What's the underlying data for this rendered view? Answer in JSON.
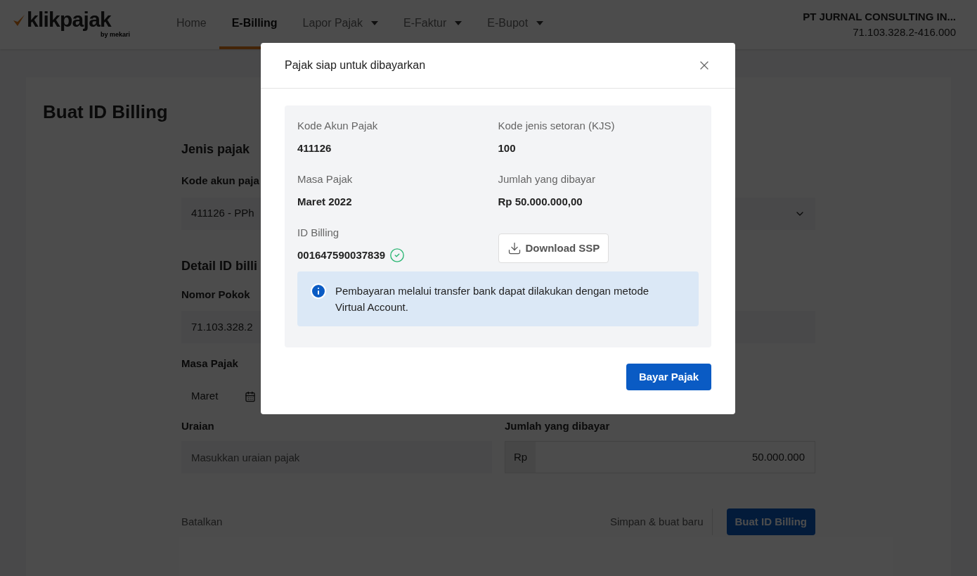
{
  "brand": {
    "name": "klikpajak",
    "tagline": "by mekari"
  },
  "nav": [
    {
      "label": "Home",
      "selected": false,
      "dropdown": false
    },
    {
      "label": "E-Billing",
      "selected": true,
      "dropdown": false
    },
    {
      "label": "Lapor Pajak",
      "selected": false,
      "dropdown": true
    },
    {
      "label": "E-Faktur",
      "selected": false,
      "dropdown": true
    },
    {
      "label": "E-Bupot",
      "selected": false,
      "dropdown": true
    }
  ],
  "account": {
    "company": "PT JURNAL CONSULTING IN...",
    "npwp": "71.103.328.2-416.000"
  },
  "page": {
    "title": "Buat ID Billing",
    "section_1": "Jenis pajak",
    "kode_akun_label": "Kode akun paja",
    "kode_akun_value": "411126 - PPh",
    "section_2": "Detail ID billi",
    "npwp_label": "Nomor Pokok",
    "npwp_value": "71.103.328.2",
    "masa_label": "Masa Pajak",
    "masa_value": "Maret",
    "uraian_label": "Uraian",
    "uraian_placeholder": "Masukkan uraian pajak",
    "jumlah_label": "Jumlah yang dibayar",
    "currency": "Rp",
    "jumlah_value": "50.000.000",
    "buttons": [
      "Batalkan",
      "Simpan & buat baru",
      "Buat ID Billing"
    ]
  },
  "modal": {
    "title": "Pajak siap untuk dibayarkan",
    "fields": [
      {
        "label": "Kode Akun Pajak",
        "value": "411126"
      },
      {
        "label": "Kode jenis setoran (KJS)",
        "value": "100"
      },
      {
        "label": "Masa Pajak",
        "value": "Maret 2022"
      },
      {
        "label": "Jumlah yang dibayar",
        "value": "Rp 50.000.000,00"
      }
    ],
    "billing_label": "ID Billing",
    "billing_value": "001647590037839",
    "verified": true,
    "download_button": "Download SSP",
    "info": "Pembayaran melalui transfer bank dapat dilakukan dengan metode Virtual Account.",
    "primary_button": "Bayar Pajak"
  }
}
